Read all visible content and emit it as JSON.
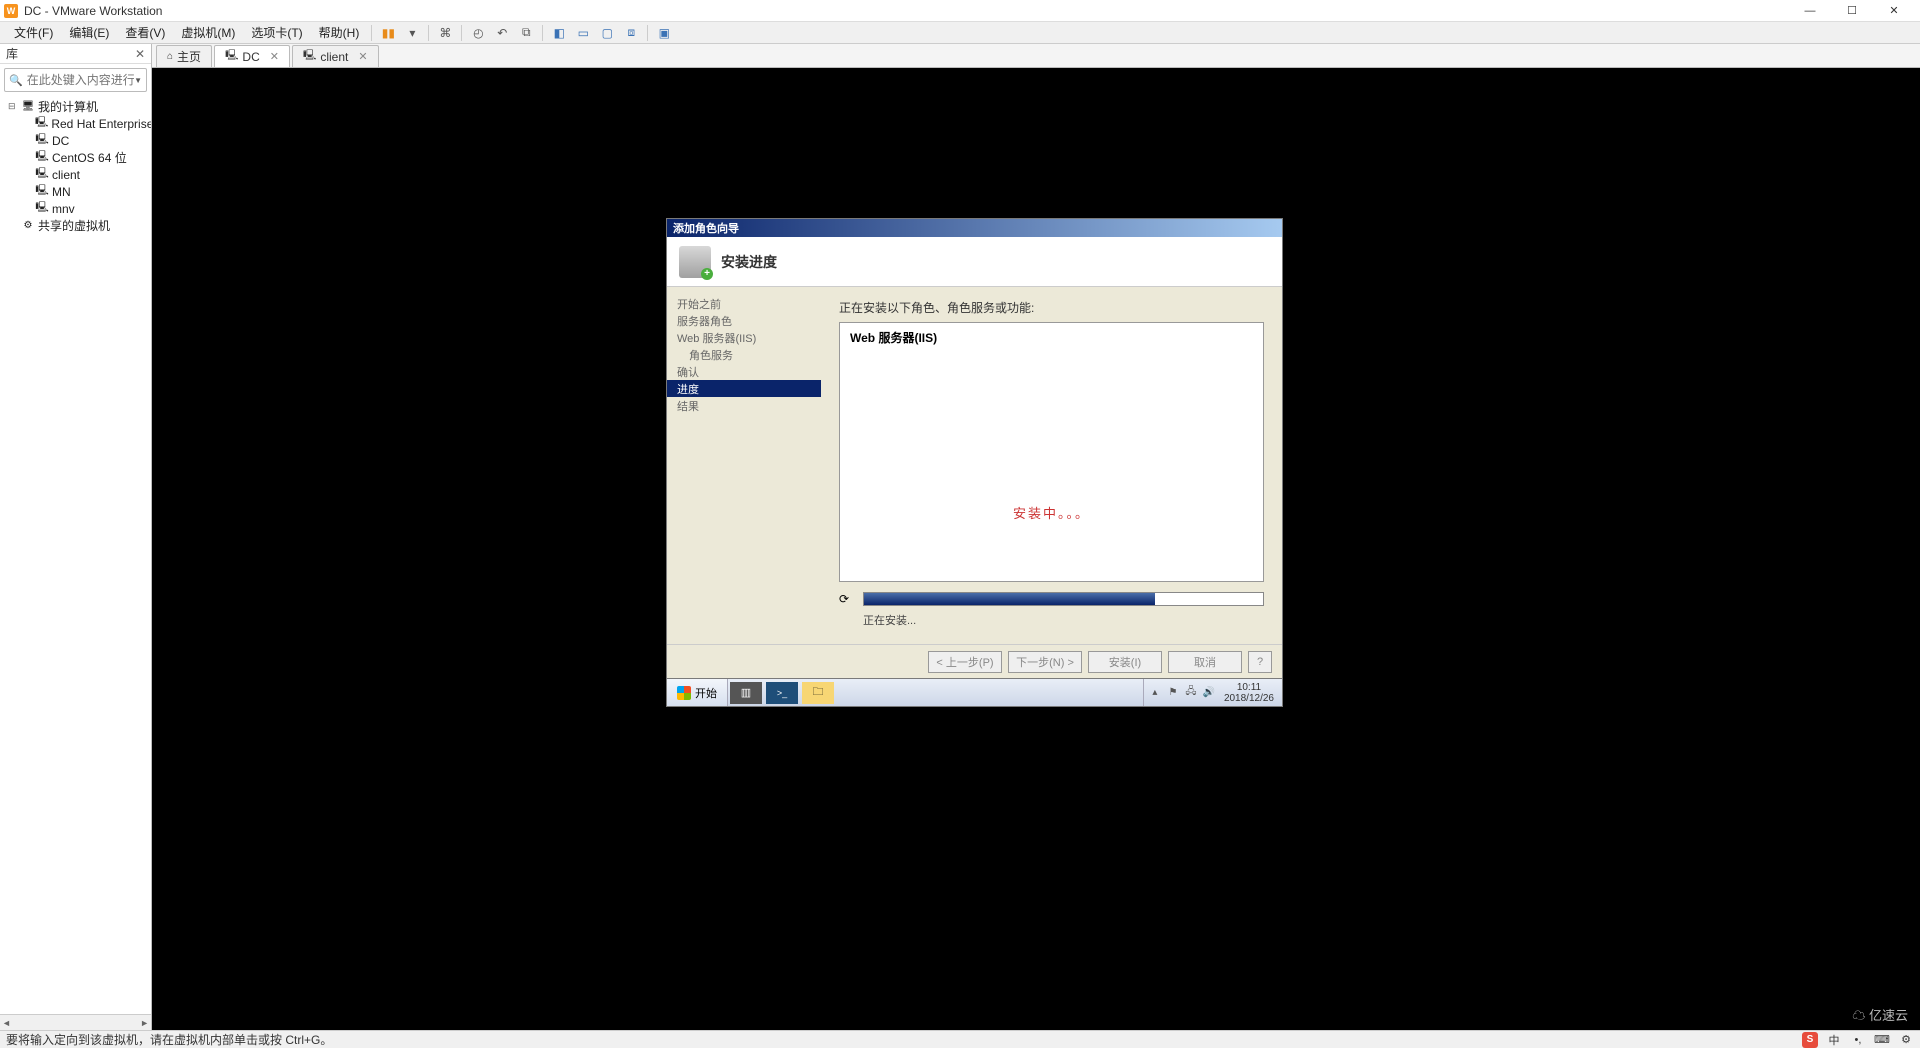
{
  "titlebar": {
    "caption": "DC - VMware Workstation"
  },
  "menubar": {
    "items": [
      "文件(F)",
      "编辑(E)",
      "查看(V)",
      "虚拟机(M)",
      "选项卡(T)",
      "帮助(H)"
    ]
  },
  "sidebar": {
    "title": "库",
    "search_placeholder": "在此处键入内容进行...",
    "nodes": [
      {
        "label": "我的计算机",
        "level": 1,
        "icon": "pc-icon",
        "exp": "⊟"
      },
      {
        "label": "Red Hat Enterprise L",
        "level": 2,
        "icon": "vm-icon"
      },
      {
        "label": "DC",
        "level": 2,
        "icon": "vm-icon"
      },
      {
        "label": "CentOS 64 位",
        "level": 2,
        "icon": "vm-icon"
      },
      {
        "label": "client",
        "level": 2,
        "icon": "vm-icon"
      },
      {
        "label": "MN",
        "level": 2,
        "icon": "vm-icon"
      },
      {
        "label": "mnv",
        "level": 2,
        "icon": "vm-icon"
      },
      {
        "label": "共享的虚拟机",
        "level": 1,
        "icon": "shared-icon",
        "exp": ""
      }
    ]
  },
  "tabs": [
    {
      "label": "主页",
      "icon": "home-icon",
      "closable": false,
      "active": false
    },
    {
      "label": "DC",
      "icon": "vm-icon",
      "closable": true,
      "active": true
    },
    {
      "label": "client",
      "icon": "vm-icon",
      "closable": true,
      "active": false
    }
  ],
  "wizard": {
    "title": "添加角色向导",
    "header": "安装进度",
    "nav": [
      {
        "label": "开始之前",
        "sel": false
      },
      {
        "label": "服务器角色",
        "sel": false
      },
      {
        "label": "Web 服务器(IIS)",
        "sel": false
      },
      {
        "label": "角色服务",
        "sel": false,
        "indent": true
      },
      {
        "label": "确认",
        "sel": false
      },
      {
        "label": "进度",
        "sel": true
      },
      {
        "label": "结果",
        "sel": false
      }
    ],
    "prompt": "正在安装以下角色、角色服务或功能:",
    "role_item": "Web 服务器(IIS)",
    "installing_text": "安装中。。。",
    "progress_text": "正在安装...",
    "buttons": {
      "prev": "< 上一步(P)",
      "next": "下一步(N) >",
      "install": "安装(I)",
      "cancel": "取消"
    }
  },
  "guest_taskbar": {
    "start": "开始",
    "time": "10:11",
    "date": "2018/12/26"
  },
  "statusbar": {
    "message": "要将输入定向到该虚拟机，请在虚拟机内部单击或按 Ctrl+G。",
    "ime_label": "中",
    "watermark": "亿速云"
  }
}
